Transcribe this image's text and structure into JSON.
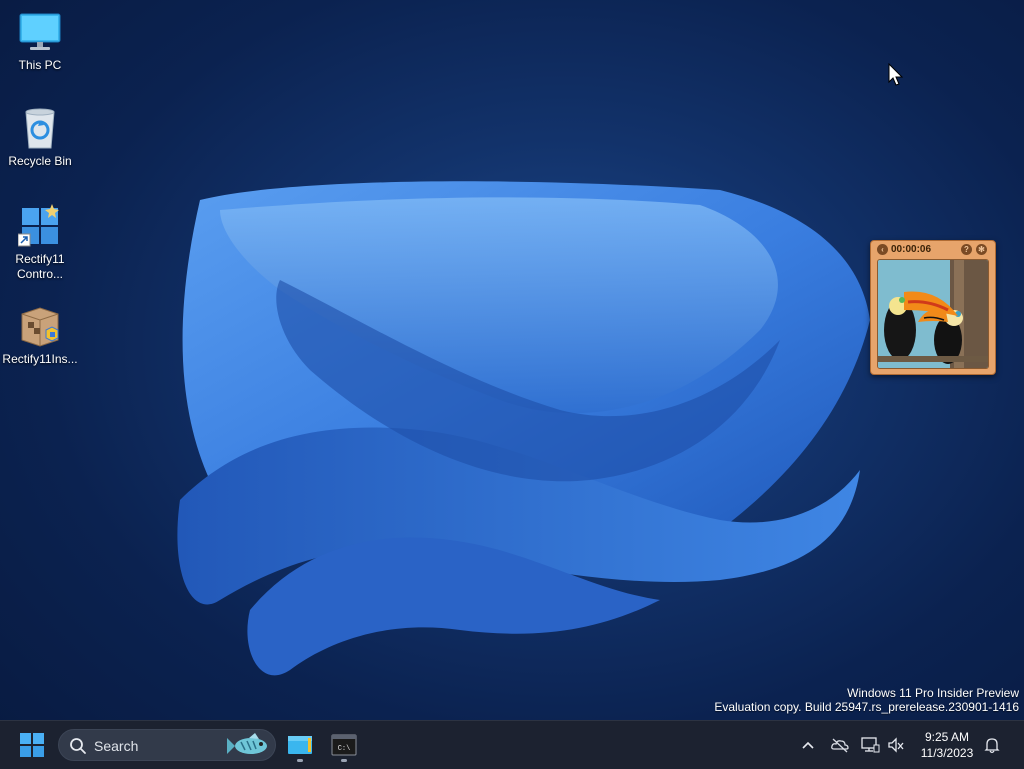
{
  "desktop": {
    "icons": [
      {
        "label": "This PC"
      },
      {
        "label": "Recycle Bin"
      },
      {
        "label": "Rectify11\nContro..."
      },
      {
        "label": "Rectify11Ins..."
      }
    ]
  },
  "gadget": {
    "timer": "00:00:06",
    "help_glyph": "?",
    "image_subject": "toucans"
  },
  "watermark": {
    "line1": "Windows 11 Pro Insider Preview",
    "line2": "Evaluation copy. Build 25947.rs_prerelease.230901-1416"
  },
  "taskbar": {
    "search_label": "Search",
    "apps": [
      {
        "name": "File Explorer",
        "icon": "file-explorer-icon"
      },
      {
        "name": "Command Prompt",
        "icon": "cmd-icon",
        "glyph": "C:\\"
      }
    ],
    "clock": {
      "time": "9:25 AM",
      "date": "11/3/2023"
    }
  },
  "colors": {
    "accent": "#4aa3f0",
    "taskbar_bg": "#1c2230",
    "gadget_frame": "#e7a46b"
  }
}
